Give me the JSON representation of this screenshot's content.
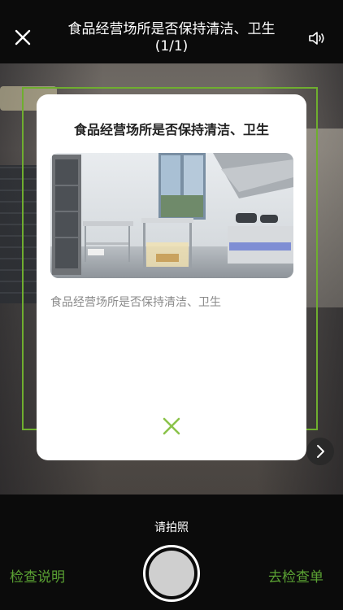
{
  "header": {
    "title": "食品经营场所是否保持清洁、卫生",
    "counter": "(1/1)"
  },
  "icons": {
    "close": "close-icon",
    "sound": "speaker-icon",
    "next": "chevron-right-icon",
    "modal_close": "close-icon"
  },
  "colors": {
    "accent_green": "#5aa133",
    "frame_green": "#6fae2f"
  },
  "modal": {
    "title": "食品经营场所是否保持清洁、卫生",
    "description": "食品经营场所是否保持清洁、卫生"
  },
  "footer": {
    "hint": "请拍照",
    "left_link": "检查说明",
    "right_link": "去检查单"
  }
}
